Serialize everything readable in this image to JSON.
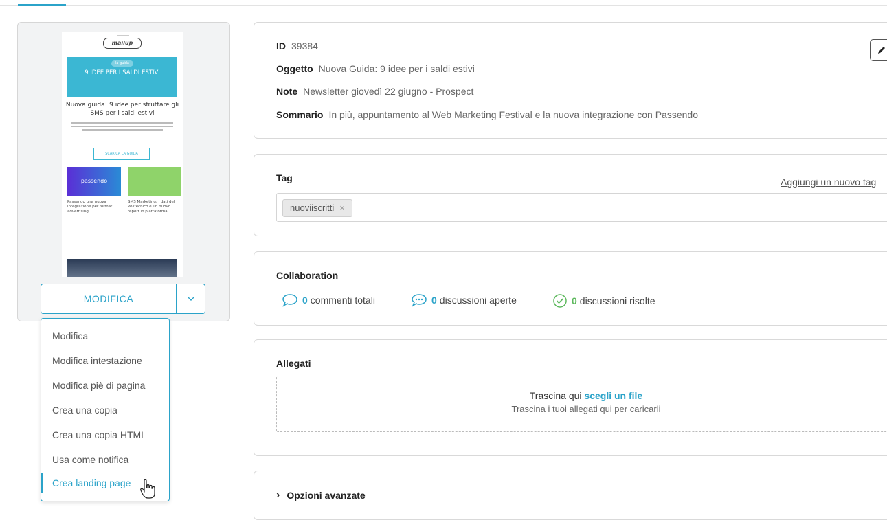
{
  "preview": {
    "logo_text": "mailup",
    "banner_pill": "la guida",
    "banner_title": "9 IDEE PER I SALDI ESTIVI",
    "headline": "Nuova guida! 9 idee per sfruttare gli SMS per i saldi estivi",
    "cta": "SCARICA LA GUIDA",
    "passendo": "passendo",
    "col1_title": "Passendo una nuova integrazione per format advertising",
    "col2_title": "SMS Marketing: i dati del Politecnico e un nuovo report in piattaforma"
  },
  "split_button": {
    "label": "MODIFICA"
  },
  "menu": {
    "items": [
      "Modifica",
      "Modifica intestazione",
      "Modifica piè di pagina",
      "Crea una copia",
      "Crea una copia HTML",
      "Usa come notifica",
      "Crea landing page"
    ],
    "active_index": 6
  },
  "info": {
    "id_label": "ID",
    "id_value": "39384",
    "subject_label": "Oggetto",
    "subject_value": "Nuova Guida: 9 idee per i saldi estivi",
    "note_label": "Note",
    "note_value": "Newsletter giovedì 22 giugno - Prospect",
    "summary_label": "Sommario",
    "summary_value": "In più, appuntamento al Web Marketing Festival e la nuova integrazione con Passendo"
  },
  "tags": {
    "title": "Tag",
    "add_link": "Aggiungi un nuovo tag",
    "chips": [
      "nuoviiscritti"
    ],
    "remove_symbol": "×"
  },
  "collaboration": {
    "title": "Collaboration",
    "comments_count": "0",
    "comments_label": "commenti totali",
    "open_count": "0",
    "open_label": "discussioni aperte",
    "resolved_count": "0",
    "resolved_label": "discussioni risolte"
  },
  "attachments": {
    "title": "Allegati",
    "drop_text": "Trascina qui",
    "drop_link": "scegli un file",
    "drop_hint": "Trascina i tuoi allegati qui per caricarli"
  },
  "advanced": {
    "chevron": "›",
    "label": "Opzioni avanzate"
  },
  "colors": {
    "accent": "#2ba3c9",
    "resolved": "#5cb85c",
    "border": "#d9d9d9"
  }
}
